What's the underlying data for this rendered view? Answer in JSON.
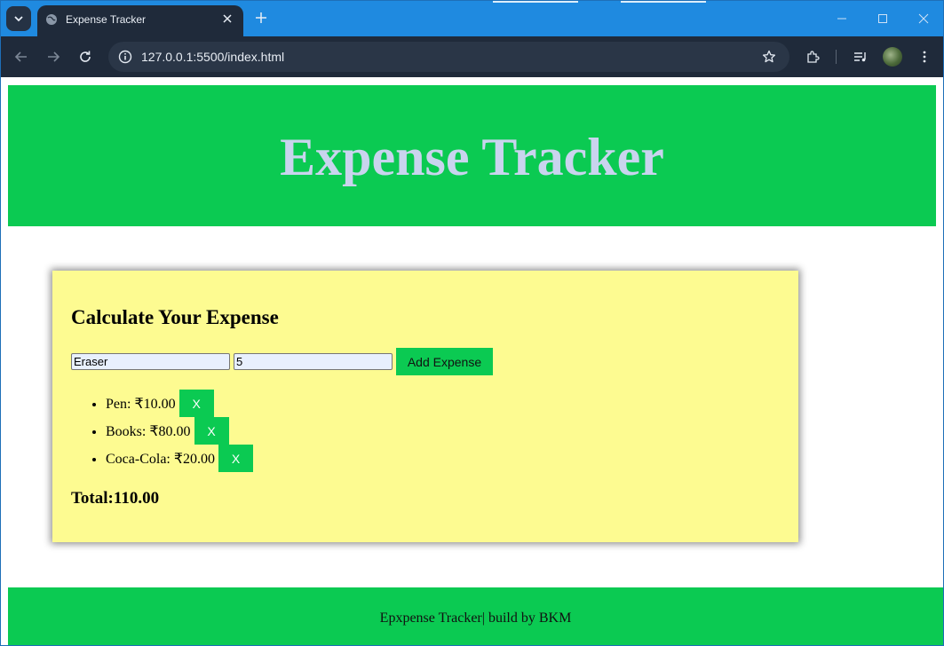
{
  "browser": {
    "tab": {
      "title": "Expense Tracker",
      "favicon": "globe-icon",
      "close_icon": "close-icon"
    },
    "new_tab_icon": "plus-icon",
    "url": "127.0.0.1:5500/index.html",
    "nav_icons": [
      "back-arrow-icon",
      "forward-arrow-icon",
      "reload-icon"
    ],
    "toolbar_icons": [
      "bookmark-star-icon",
      "extensions-icon",
      "media-control-icon",
      "profile-avatar",
      "more-menu-icon"
    ],
    "window_controls": [
      "minimize-icon",
      "maximize-icon",
      "close-window-icon"
    ],
    "colors": {
      "tabstrip": "#1f8ae0",
      "toolbar": "#1f2a3a"
    }
  },
  "page": {
    "header": {
      "title": "Expense Tracker"
    },
    "card": {
      "heading": "Calculate Your Expense",
      "form": {
        "name_value": "Eraser",
        "amount_value": "5",
        "add_button_label": "Add Expense"
      },
      "expenses": [
        {
          "text": "Pen: ₹10.00",
          "delete_label": "X"
        },
        {
          "text": "Books: ₹80.00",
          "delete_label": "X"
        },
        {
          "text": "Coca-Cola: ₹20.00",
          "delete_label": "X"
        }
      ],
      "total_text": "Total:110.00"
    },
    "footer": {
      "text": "Epxpense Tracker| build by BKM"
    },
    "colors": {
      "accent_green": "#0bca52",
      "card_background": "#fdfb91",
      "header_title": "#c9d4ee"
    }
  }
}
